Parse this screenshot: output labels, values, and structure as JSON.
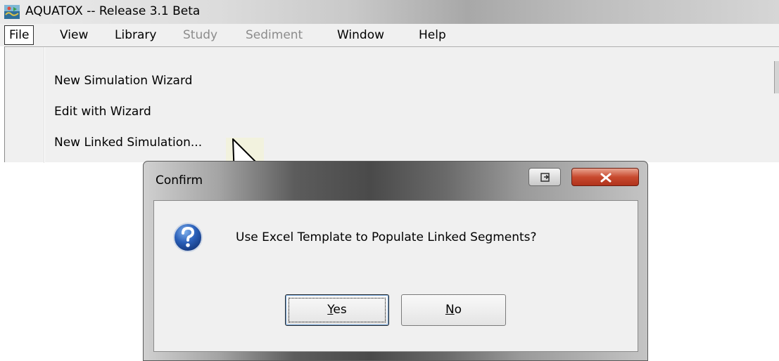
{
  "window": {
    "title": "AQUATOX -- Release 3.1 Beta"
  },
  "menubar": {
    "items": [
      {
        "label": "File",
        "state": "open"
      },
      {
        "label": "View",
        "state": "enabled"
      },
      {
        "label": "Library",
        "state": "enabled"
      },
      {
        "label": "Study",
        "state": "disabled"
      },
      {
        "label": "Sediment",
        "state": "disabled"
      },
      {
        "label": "Window",
        "state": "enabled"
      },
      {
        "label": "Help",
        "state": "enabled"
      }
    ]
  },
  "file_menu": {
    "items": [
      {
        "label": "New Simulation Wizard"
      },
      {
        "label": "Edit with Wizard"
      },
      {
        "label": "New Linked Simulation..."
      }
    ]
  },
  "dialog": {
    "title": "Confirm",
    "message": "Use Excel Template to Populate Linked Segments?",
    "icon": "question-icon",
    "yes_underline": "Y",
    "yes_rest": "es",
    "no_underline": "N",
    "no_rest": "o",
    "close_glyph": "x"
  },
  "colors": {
    "close_button": "#c84a2f",
    "question_icon": "#1f4fa3",
    "disabled_text": "#8c8c8c"
  }
}
